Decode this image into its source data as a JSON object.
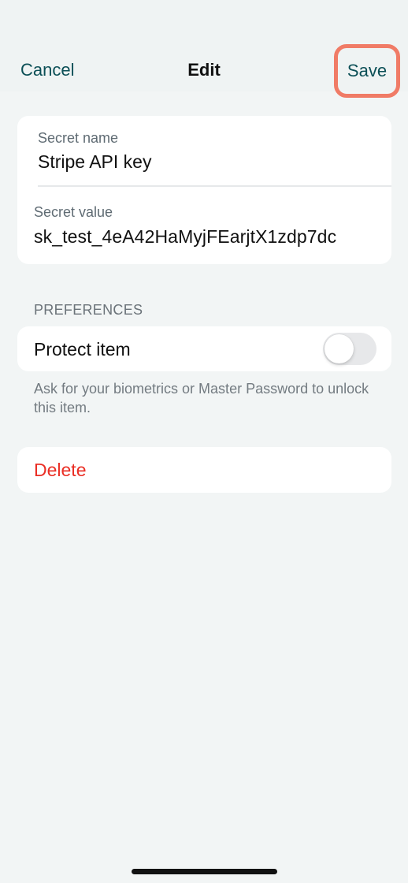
{
  "nav": {
    "cancel_label": "Cancel",
    "title": "Edit",
    "save_label": "Save"
  },
  "secret": {
    "name_label": "Secret name",
    "name_value": "Stripe API key",
    "value_label": "Secret value",
    "value_value": "sk_test_4eA42HaMyjFEarjtX1zdp7dc"
  },
  "preferences": {
    "header": "PREFERENCES",
    "protect_label": "Protect item",
    "protect_enabled": false,
    "footer": "Ask for your biometrics or Master Password to unlock this item."
  },
  "actions": {
    "delete_label": "Delete"
  },
  "colors": {
    "accent": "#0b4f56",
    "highlight": "#f07b66",
    "danger": "#ea2e24",
    "background": "#f2f5f5"
  }
}
